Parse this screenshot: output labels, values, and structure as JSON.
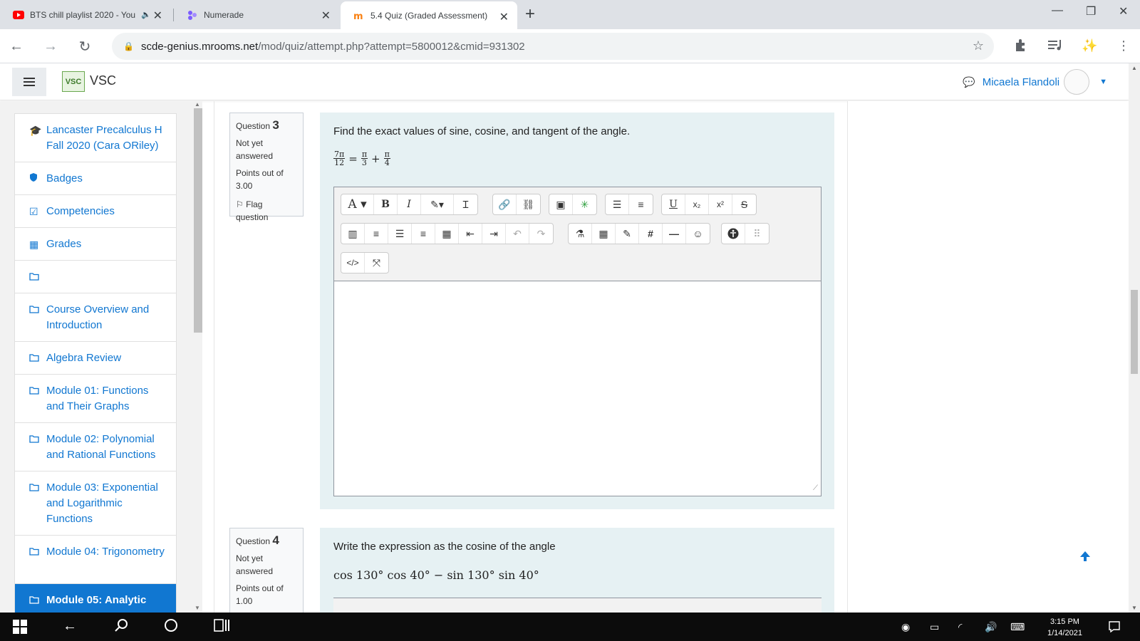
{
  "browser": {
    "tabs": [
      {
        "title": "BTS chill playlist 2020 - You",
        "icon": "youtube-icon",
        "active": false
      },
      {
        "title": "Numerade",
        "icon": "numerade-icon",
        "active": false
      },
      {
        "title": "5.4 Quiz (Graded Assessment)",
        "icon": "moodle-icon",
        "active": true
      }
    ],
    "url_host": "scde-genius.mrooms.net",
    "url_path": "/mod/quiz/attempt.php?attempt=5800012&cmid=931302"
  },
  "header": {
    "site_name": "VSC",
    "logo_text": "VSC",
    "user_name": "Micaela Flandoli"
  },
  "sidebar": {
    "items": [
      {
        "label": "Lancaster Precalculus H Fall 2020 (Cara ORiley)",
        "icon": "graduation-cap-icon"
      },
      {
        "label": "Badges",
        "icon": "shield-icon"
      },
      {
        "label": "Competencies",
        "icon": "checkbox-icon"
      },
      {
        "label": "Grades",
        "icon": "table-icon"
      },
      {
        "label": "",
        "icon": "folder-icon"
      },
      {
        "label": "Course Overview and Introduction",
        "icon": "folder-icon"
      },
      {
        "label": "Algebra Review",
        "icon": "folder-icon"
      },
      {
        "label": "Module 01: Functions and Their Graphs",
        "icon": "folder-icon"
      },
      {
        "label": "Module 02: Polynomial and Rational Functions",
        "icon": "folder-icon"
      },
      {
        "label": "Module 03: Exponential and Logarithmic Functions",
        "icon": "folder-icon"
      },
      {
        "label": "Module 04: Trigonometry",
        "icon": "folder-icon"
      },
      {
        "label": "Module 05: Analytic",
        "icon": "folder-icon",
        "active": true
      }
    ]
  },
  "questions": [
    {
      "label": "Question",
      "number": "3",
      "status": "Not yet answered",
      "points": "Points out of 3.00",
      "flag": "Flag question",
      "text": "Find the exact values of sine, cosine, and tangent of the angle.",
      "math": {
        "lhs_num": "7π",
        "lhs_den": "12",
        "eq": "=",
        "a_num": "π",
        "a_den": "3",
        "plus": "+",
        "b_num": "π",
        "b_den": "4"
      }
    },
    {
      "label": "Question",
      "number": "4",
      "status": "Not yet answered",
      "points": "Points out of 1.00",
      "text": "Write the expression as the cosine of the angle",
      "math_line": "cos 130° cos 40° − sin 130° sin 40°"
    }
  ],
  "editor_toolbar": {
    "row1": [
      [
        "font-size-icon",
        "bold-icon",
        "italic-icon",
        "text-color-icon",
        "clear-format-icon"
      ],
      [
        "link-icon",
        "unlink-icon"
      ],
      [
        "image-icon",
        "media-icon"
      ],
      [
        "bullet-list-icon",
        "numbered-list-icon"
      ],
      [
        "underline-icon",
        "subscript-icon",
        "superscript-icon",
        "strikethrough-icon"
      ]
    ],
    "row2": [
      [
        "columns-icon",
        "align-left-icon",
        "align-center-icon",
        "align-right-icon",
        "table-icon",
        "outdent-icon",
        "indent-icon",
        "undo-icon",
        "redo-icon"
      ],
      [
        "equation-icon",
        "calculator-icon",
        "edit-icon",
        "hash-icon",
        "horizontal-rule-icon",
        "emoji-icon"
      ],
      [
        "accessibility-icon",
        "screenreader-icon"
      ]
    ],
    "row3": [
      [
        "html-icon",
        "fullscreen-icon"
      ]
    ]
  },
  "taskbar": {
    "time": "3:15 PM",
    "date": "1/14/2021"
  },
  "colors": {
    "accent": "#1177d1",
    "question_bg": "#e6f1f3",
    "drawer_bg": "#f2f2f2",
    "taskbar": "#0c0c0c"
  }
}
